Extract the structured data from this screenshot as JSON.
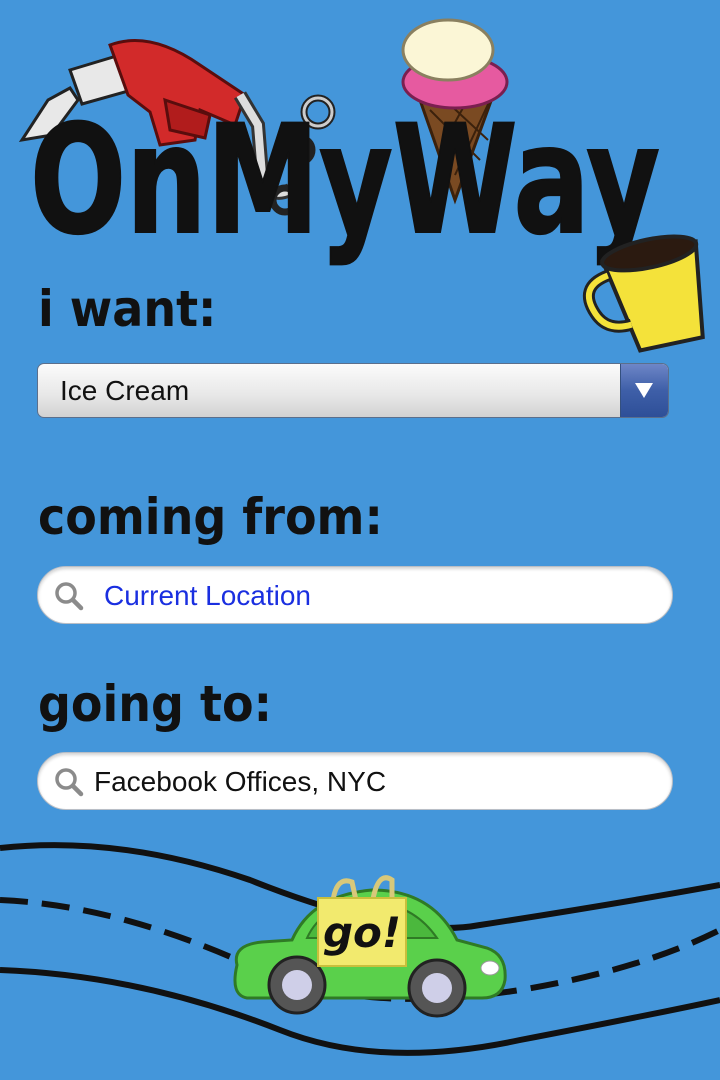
{
  "app": {
    "logo_text": "OnMyWay"
  },
  "form": {
    "want_label": "i want:",
    "want_selected": "Ice Cream",
    "from_label": "coming from:",
    "from_value": "Current Location",
    "to_label": "going to:",
    "to_value": "Facebook Offices, NYC"
  },
  "actions": {
    "go_label": "go!"
  },
  "icons": {
    "logo_decorations": [
      "gas-pump-icon",
      "ice-cream-cone-icon",
      "coffee-mug-icon"
    ],
    "search": "magnifier-icon",
    "dropdown": "triangle-down-icon",
    "car": "car-icon"
  },
  "colors": {
    "background": "#4496da",
    "link_text": "#1a2fe0",
    "car": "#5ad04b",
    "sticky_note": "#f2ea6e"
  }
}
